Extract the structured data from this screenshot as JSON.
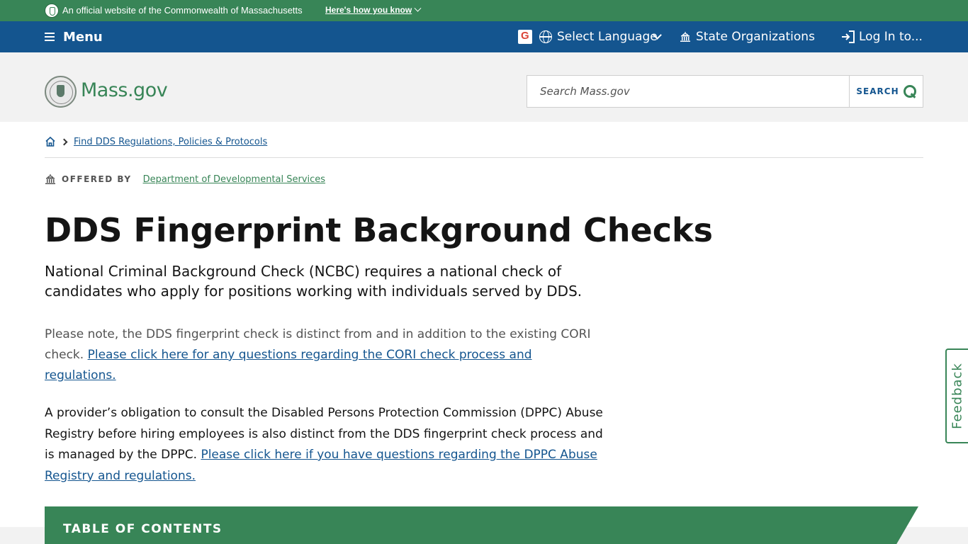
{
  "official_banner": {
    "text": "An official website of the Commonwealth of Massachusetts",
    "how_know": "Here's how you know"
  },
  "nav": {
    "menu_label": "Menu",
    "language_label": "Select Language",
    "orgs_label": "State Organizations",
    "login_label": "Log In to..."
  },
  "header": {
    "logo_text": "Mass.gov",
    "search_placeholder": "Search Mass.gov",
    "search_button": "SEARCH"
  },
  "breadcrumb": {
    "item": "Find DDS Regulations, Policies & Protocols"
  },
  "offered_by": {
    "label": "OFFERED BY",
    "org": "Department of Developmental Services"
  },
  "main": {
    "title": "DDS Fingerprint Background Checks",
    "lead": "National Criminal Background Check (NCBC) requires a national check of candidates who apply for positions working with individuals served by DDS.",
    "para1_text": "Please note, the DDS fingerprint check is distinct from and in addition to the existing CORI check. ",
    "para1_link": "Please click here for any questions regarding the CORI check process and regulations.",
    "para2_text": "A provider’s obligation to consult the Disabled Persons Protection Commission (DPPC) Abuse Registry before hiring employees is also distinct from the DDS fingerprint check process and is managed by the DPPC. ",
    "para2_link": "Please click here if you have questions regarding the DPPC Abuse Registry and regulations."
  },
  "toc": {
    "label": "TABLE OF CONTENTS"
  },
  "feedback": {
    "label": "Feedback"
  },
  "colors": {
    "green": "#388557",
    "blue": "#14558f",
    "header_bg": "#f2f2f2"
  }
}
